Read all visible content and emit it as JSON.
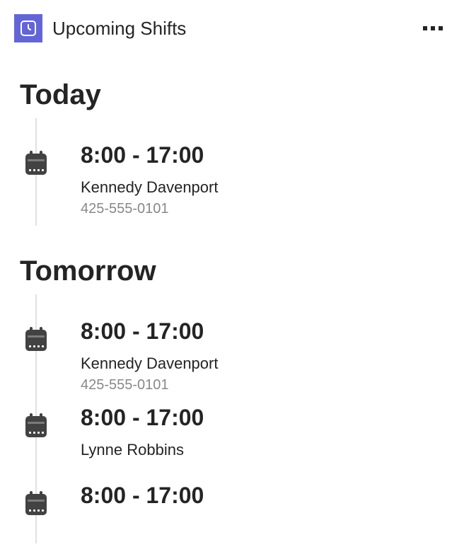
{
  "header": {
    "title": "Upcoming Shifts"
  },
  "sections": [
    {
      "title": "Today",
      "shifts": [
        {
          "time": "8:00 - 17:00",
          "name": "Kennedy Davenport",
          "phone": "425-555-0101"
        }
      ]
    },
    {
      "title": "Tomorrow",
      "shifts": [
        {
          "time": "8:00 - 17:00",
          "name": "Kennedy Davenport",
          "phone": "425-555-0101"
        },
        {
          "time": "8:00 - 17:00",
          "name": "Lynne Robbins",
          "phone": ""
        },
        {
          "time": "8:00 - 17:00",
          "name": "",
          "phone": ""
        }
      ]
    }
  ]
}
